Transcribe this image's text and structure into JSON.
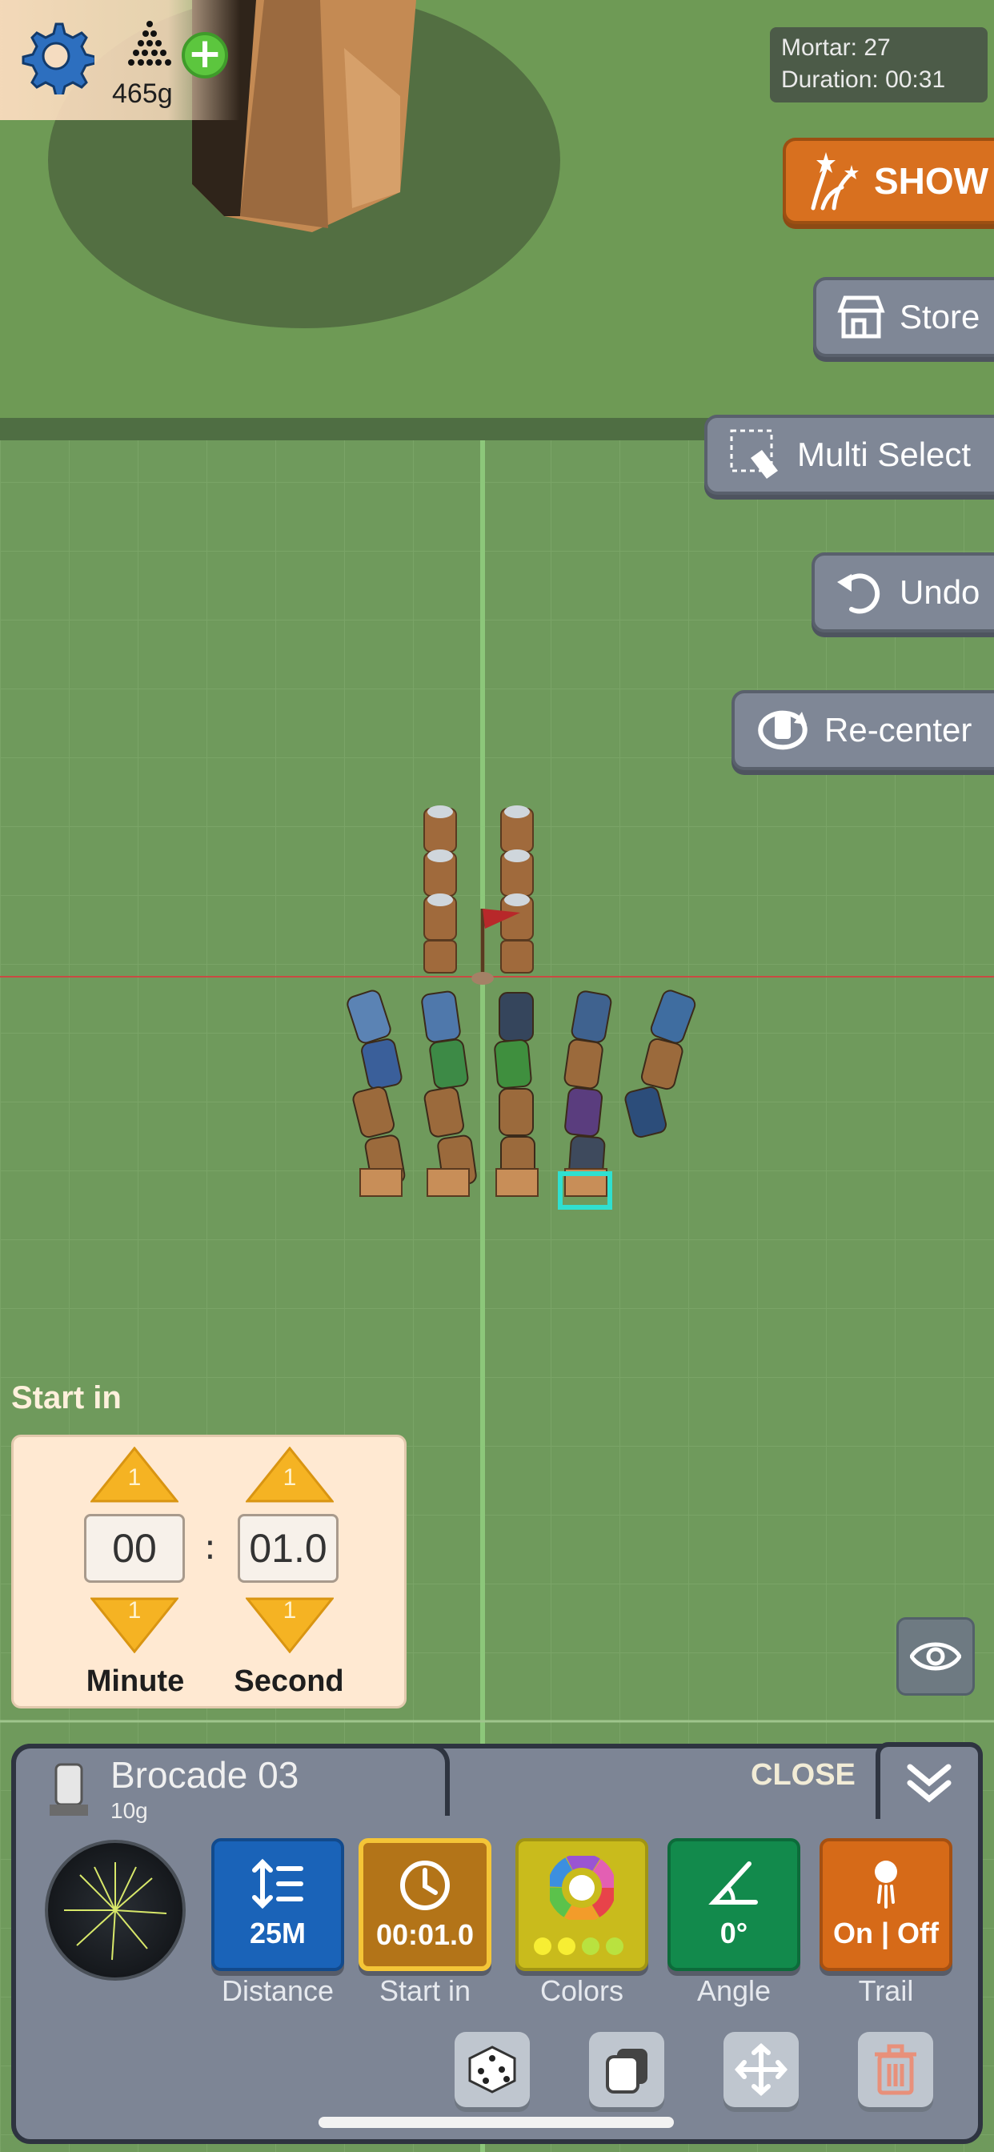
{
  "resources": {
    "powder_amount": "465g"
  },
  "stats": {
    "mortar_line": "Mortar: 27",
    "duration_line": "Duration: 00:31"
  },
  "side_buttons": {
    "show": "SHOW",
    "store": "Store",
    "multi_select": "Multi Select",
    "undo": "Undo",
    "recenter": "Re-center"
  },
  "start_in": {
    "title": "Start in",
    "minute_value": "00",
    "second_value": "01.0",
    "minute_up": "1",
    "minute_down": "1",
    "second_up": "1",
    "second_down": "1",
    "separator": ":",
    "minute_label": "Minute",
    "second_label": "Second"
  },
  "item": {
    "name": "Brocade 03",
    "weight": "10g",
    "close_label": "CLOSE"
  },
  "properties": [
    {
      "key": "distance",
      "value": "25M",
      "label": "Distance",
      "color": "#1a63b8"
    },
    {
      "key": "start",
      "value": "00:01.0",
      "label": "Start in",
      "color": "#b37418"
    },
    {
      "key": "colors",
      "value": "",
      "label": "Colors",
      "color": "#c9bb1c"
    },
    {
      "key": "angle",
      "value": "0°",
      "label": "Angle",
      "color": "#128a4c"
    },
    {
      "key": "trail",
      "value": "On | Off",
      "label": "Trail",
      "color": "#d66a18"
    }
  ],
  "tools": [
    "dice-icon",
    "duplicate-icon",
    "move-icon",
    "trash-icon"
  ]
}
